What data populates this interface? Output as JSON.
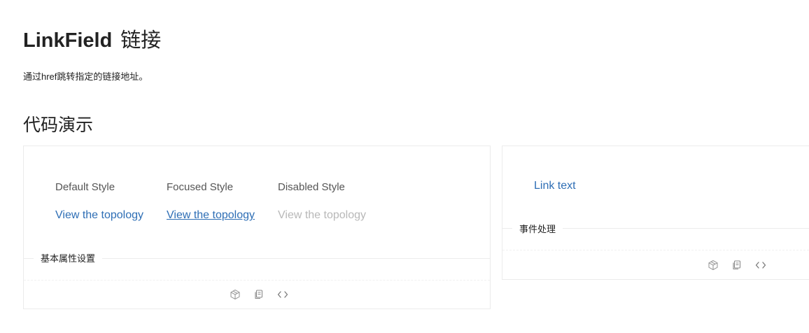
{
  "header": {
    "title": "LinkField",
    "title_cn": "链接",
    "description": "通过href跳转指定的链接地址。"
  },
  "section": {
    "title": "代码演示"
  },
  "demo_basic": {
    "columns": [
      {
        "label": "Default Style",
        "link": "View the topology",
        "state": "default"
      },
      {
        "label": "Focused Style",
        "link": "View the topology",
        "state": "focused"
      },
      {
        "label": "Disabled Style",
        "link": "View the topology",
        "state": "disabled"
      }
    ],
    "meta_title": "基本属性设置",
    "actions": [
      "codesandbox-icon",
      "copy-icon",
      "code-icon"
    ]
  },
  "demo_events": {
    "link": "Link text",
    "meta_title": "事件处理",
    "actions": [
      "codesandbox-icon",
      "copy-icon",
      "code-icon"
    ]
  },
  "colors": {
    "link": "#2e6eb5",
    "disabled_link": "#b8b8b8",
    "border": "#ebebeb"
  }
}
